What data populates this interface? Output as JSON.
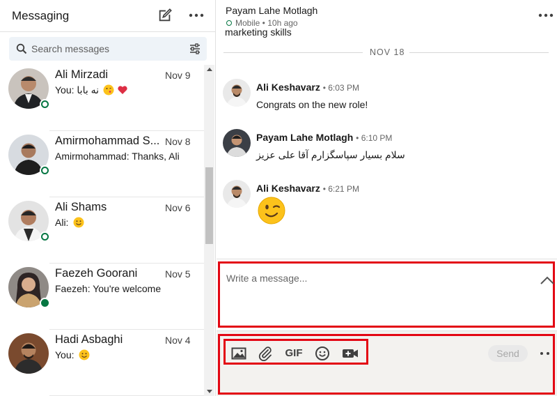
{
  "sidebar": {
    "title": "Messaging",
    "search": {
      "placeholder": "Search messages"
    },
    "conversations": [
      {
        "name": "Ali Mirzadi",
        "date": "Nov 9",
        "preview": "You: نه بابا",
        "preview_emoji": [
          "kissing-face-emoji",
          "red-heart-emoji"
        ],
        "presence": "online"
      },
      {
        "name": "Amirmohammad S...",
        "date": "Nov 8",
        "preview": "Amirmohammad: Thanks, Ali",
        "presence": "online"
      },
      {
        "name": "Ali Shams",
        "date": "Nov 6",
        "preview": "Ali:",
        "preview_emoji": [
          "smiling-face-emoji"
        ],
        "presence": "online"
      },
      {
        "name": "Faezeh Goorani",
        "date": "Nov 5",
        "preview": "Faezeh: You're welcome",
        "presence": "active"
      },
      {
        "name": "Hadi Asbaghi",
        "date": "Nov 4",
        "preview": "You:",
        "preview_emoji": [
          "smiling-face-emoji"
        ],
        "presence": "none"
      }
    ]
  },
  "thread": {
    "name": "Payam Lahe Motlagh",
    "status": "Mobile • 10h ago",
    "previous_text": "marketing skills",
    "day_separator": "NOV 18",
    "messages": [
      {
        "sender": "Ali Keshavarz",
        "time": "• 6:03 PM",
        "text": "Congrats on the new role!"
      },
      {
        "sender": "Payam Lahe Motlagh",
        "time": "• 6:10 PM",
        "text": "سلام بسیار سپاسگزارم آقا علی عزیز"
      },
      {
        "sender": "Ali Keshavarz",
        "time": "• 6:21 PM",
        "text": "",
        "emoji": "winking-face-emoji"
      }
    ]
  },
  "compose": {
    "placeholder": "Write a message...",
    "gif_label": "GIF",
    "send_label": "Send"
  },
  "colors": {
    "online_green": "#057642",
    "highlight_red": "#e30613",
    "search_bg": "#eef3f8",
    "toolbar_bg": "#f3f2ef"
  }
}
